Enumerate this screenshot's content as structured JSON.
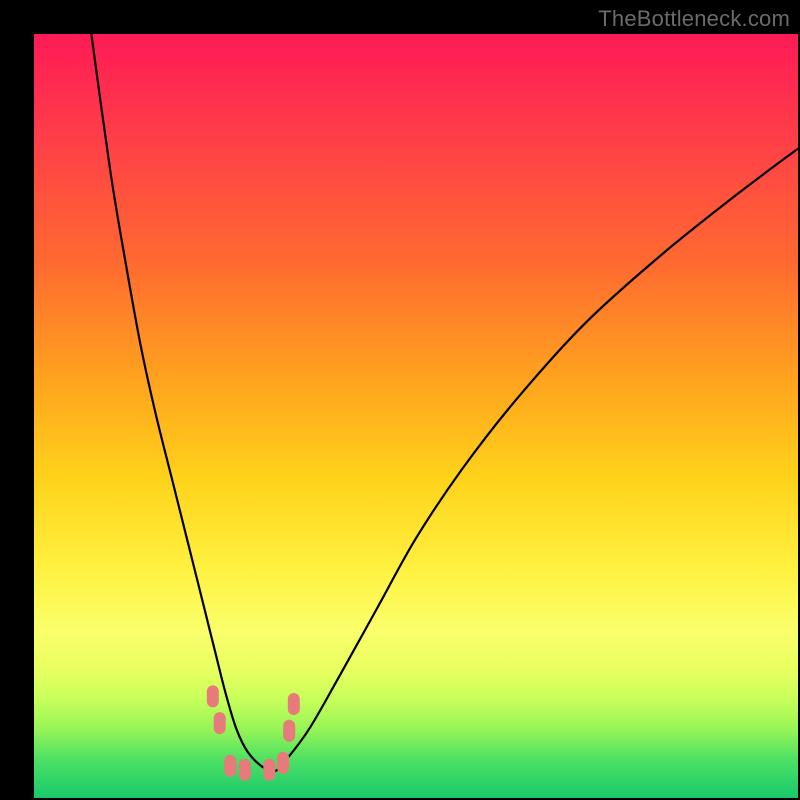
{
  "watermark": "TheBottleneck.com",
  "colors": {
    "curve_stroke": "#000000",
    "marker_fill": "#e77a7a",
    "black_border": "#000000"
  },
  "chart_data": {
    "type": "line",
    "title": "",
    "xlabel": "",
    "ylabel": "",
    "xlim": [
      0,
      100
    ],
    "ylim": [
      0,
      100
    ],
    "note": "No axes, ticks, or labels are rendered in the image; values are estimated from pixel positions within the 764×764 plot rectangle. y is inverted (0 at top). Markers are the small rounded pink dots near the trough.",
    "series": [
      {
        "name": "bottleneck-curve",
        "x": [
          7.5,
          10,
          12,
          14,
          16,
          18,
          20,
          22,
          23.5,
          25,
          26.5,
          28,
          30,
          31.5,
          33,
          36,
          40,
          45,
          50,
          56,
          63,
          72,
          82,
          92,
          100
        ],
        "y": [
          0,
          18,
          30,
          41,
          50,
          58,
          66,
          74,
          80,
          86,
          91,
          94,
          96,
          96.5,
          95,
          91,
          84,
          75,
          66,
          57,
          48,
          38,
          29,
          21,
          15
        ]
      }
    ],
    "markers": [
      {
        "x": 23.4,
        "y": 86.7
      },
      {
        "x": 24.3,
        "y": 90.2
      },
      {
        "x": 25.7,
        "y": 95.8
      },
      {
        "x": 27.6,
        "y": 96.3
      },
      {
        "x": 30.8,
        "y": 96.3
      },
      {
        "x": 32.6,
        "y": 95.4
      },
      {
        "x": 33.4,
        "y": 91.2
      },
      {
        "x": 34.0,
        "y": 87.7
      }
    ]
  }
}
